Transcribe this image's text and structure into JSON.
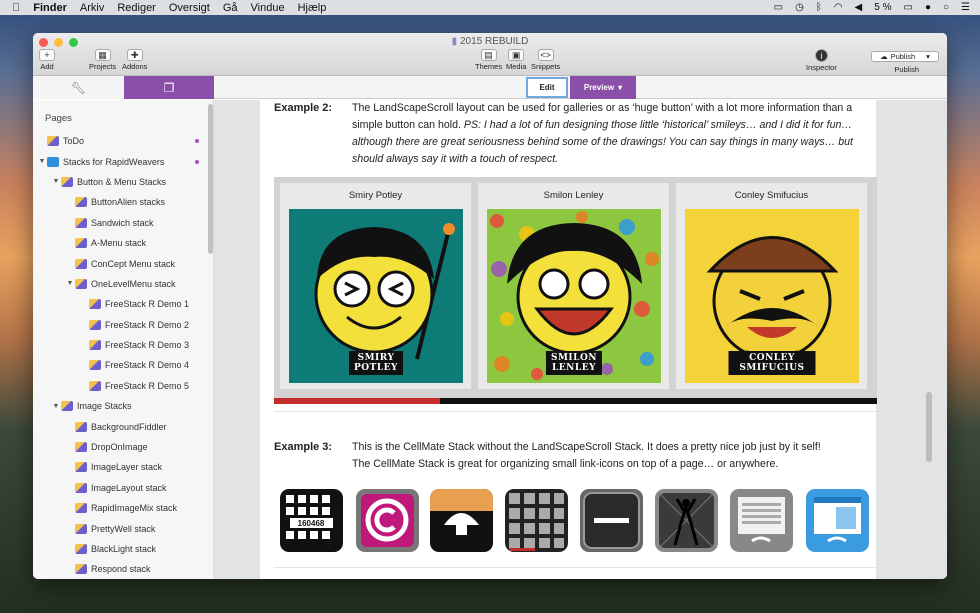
{
  "menubar": {
    "apple": "",
    "items": [
      "Finder",
      "Arkiv",
      "Rediger",
      "Oversigt",
      "Gå",
      "Vindue",
      "Hjælp"
    ],
    "battery": "5 %"
  },
  "window": {
    "title": "2015 REBUILD"
  },
  "toolbar": {
    "add": "Add",
    "projects": "Projects",
    "addons": "Addons",
    "themes": "Themes",
    "media": "Media",
    "snippets": "Snippets",
    "inspector": "Inspector",
    "publish_btn": "Publish",
    "publish_lbl": "Publish"
  },
  "modes": {
    "edit": "Edit",
    "preview": "Preview"
  },
  "sidebar": {
    "heading": "Pages",
    "items": [
      {
        "label": "ToDo",
        "level": 0,
        "arrow": "",
        "icon": "stack",
        "dot": true
      },
      {
        "label": "Stacks for RapidWeavers",
        "level": 0,
        "arrow": "▼",
        "icon": "blue",
        "dot": true
      },
      {
        "label": "Button & Menu Stacks",
        "level": 1,
        "arrow": "▼",
        "icon": "stack",
        "dot": false
      },
      {
        "label": "ButtonAlien stacks",
        "level": 2,
        "arrow": "",
        "icon": "stack",
        "dot": false
      },
      {
        "label": "Sandwich stack",
        "level": 2,
        "arrow": "",
        "icon": "stack",
        "dot": false
      },
      {
        "label": "A-Menu stack",
        "level": 2,
        "arrow": "",
        "icon": "stack",
        "dot": false
      },
      {
        "label": "ConCept Menu stack",
        "level": 2,
        "arrow": "",
        "icon": "stack",
        "dot": false
      },
      {
        "label": "OneLevelMenu stack",
        "level": 2,
        "arrow": "▼",
        "icon": "stack",
        "dot": false
      },
      {
        "label": "FreeStack R Demo 1",
        "level": 3,
        "arrow": "",
        "icon": "stack",
        "dot": false
      },
      {
        "label": "FreeStack R Demo 2",
        "level": 3,
        "arrow": "",
        "icon": "stack",
        "dot": false
      },
      {
        "label": "FreeStack R Demo 3",
        "level": 3,
        "arrow": "",
        "icon": "stack",
        "dot": false
      },
      {
        "label": "FreeStack R Demo 4",
        "level": 3,
        "arrow": "",
        "icon": "stack",
        "dot": false
      },
      {
        "label": "FreeStack R Demo 5",
        "level": 3,
        "arrow": "",
        "icon": "stack",
        "dot": false
      },
      {
        "label": "Image Stacks",
        "level": 1,
        "arrow": "▼",
        "icon": "stack",
        "dot": false
      },
      {
        "label": "BackgroundFiddler",
        "level": 2,
        "arrow": "",
        "icon": "stack",
        "dot": false
      },
      {
        "label": "DropOnImage",
        "level": 2,
        "arrow": "",
        "icon": "stack",
        "dot": false
      },
      {
        "label": "ImageLayer stack",
        "level": 2,
        "arrow": "",
        "icon": "stack",
        "dot": false
      },
      {
        "label": "ImageLayout stack",
        "level": 2,
        "arrow": "",
        "icon": "stack",
        "dot": false
      },
      {
        "label": "RapidImageMix stack",
        "level": 2,
        "arrow": "",
        "icon": "stack",
        "dot": false
      },
      {
        "label": "PrettyWell stack",
        "level": 2,
        "arrow": "",
        "icon": "stack",
        "dot": false
      },
      {
        "label": "BlackLight stack",
        "level": 2,
        "arrow": "",
        "icon": "stack",
        "dot": false
      },
      {
        "label": "Respond stack",
        "level": 2,
        "arrow": "",
        "icon": "stack",
        "dot": false
      }
    ]
  },
  "example2": {
    "label": "Example 2:",
    "line1": "The LandScapeScroll layout can be used for galleries or as ‘huge button’ with a lot more information than a",
    "line2a": "simple button can hold. ",
    "line2b": "PS: I had a lot of fun designing those little ‘historical’ smileys… and I did it for fun…",
    "line3": "although there are great seriousness behind some of the drawings! You can say things in many ways… but",
    "line4": "should always say it with a touch of respect."
  },
  "gallery": [
    {
      "name": "Smiry Potley",
      "cap1": "SMIRY",
      "cap2": "POTLEY",
      "bg": "#0e7b77"
    },
    {
      "name": "Smilon Lenley",
      "cap1": "SMILON",
      "cap2": "LENLEY",
      "bg": "#8dc63f"
    },
    {
      "name": "Conley Smifucius",
      "cap1": "CONLEY SMIFUCIUS",
      "cap2": "",
      "bg": "#f4d33a"
    }
  ],
  "example3": {
    "label": "Example 3:",
    "line1": "This is the CellMate Stack without the LandScapeScroll Stack. It does a pretty nice job just by it self!",
    "line2": "The CellMate Stack is great for organizing small link-icons on top of a page… or anywhere.",
    "grid_number": "160468"
  },
  "icons": [
    "grid-number-icon",
    "copyright-c-icon",
    "mushroom-icon",
    "tile-grid-icon",
    "minus-box-icon",
    "dancer-icon",
    "document-lines-icon",
    "browser-window-icon"
  ],
  "colors": {
    "accent": "#8a4fa8",
    "scroll_progress": "#c42c2c",
    "dot": "#a552b8"
  }
}
